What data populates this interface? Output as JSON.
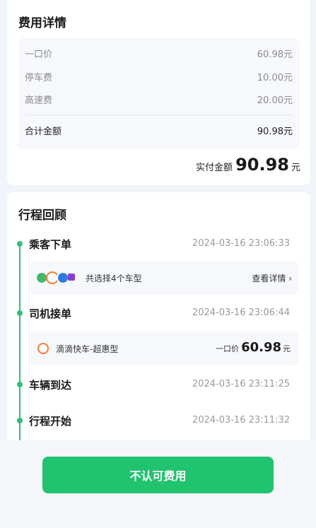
{
  "fee_details": {
    "title": "费用详情",
    "items": [
      {
        "label": "一口价",
        "value": "60.98元"
      },
      {
        "label": "停车费",
        "value": "10.00元"
      },
      {
        "label": "高速费",
        "value": "20.00元"
      }
    ],
    "total": {
      "label": "合计金额",
      "value": "90.98元"
    },
    "paid": {
      "label": "实付金额",
      "amount": "90.98",
      "unit": "元"
    }
  },
  "trip_review": {
    "title": "行程回顾",
    "steps": [
      {
        "title": "乘客下单",
        "time": "2024-03-16 23:06:33"
      },
      {
        "title": "司机接单",
        "time": "2024-03-16 23:06:44"
      },
      {
        "title": "车辆到达",
        "time": "2024-03-16 23:11:25"
      },
      {
        "title": "行程开始",
        "time": "2024-03-16 23:11:32"
      }
    ],
    "car_selection": {
      "text": "共选择4个车型",
      "link": "查看详情 ›"
    },
    "ride": {
      "name": "滴滴快车-超惠型",
      "price_label": "一口价",
      "price": "60.98",
      "unit": "元"
    }
  },
  "actions": {
    "dispute_button": "不认可费用"
  },
  "colors": {
    "accent": "#20c46e",
    "timeline": "#2cc177",
    "card_bg": "#ffffff",
    "page_bg": "#f1f4f9"
  }
}
